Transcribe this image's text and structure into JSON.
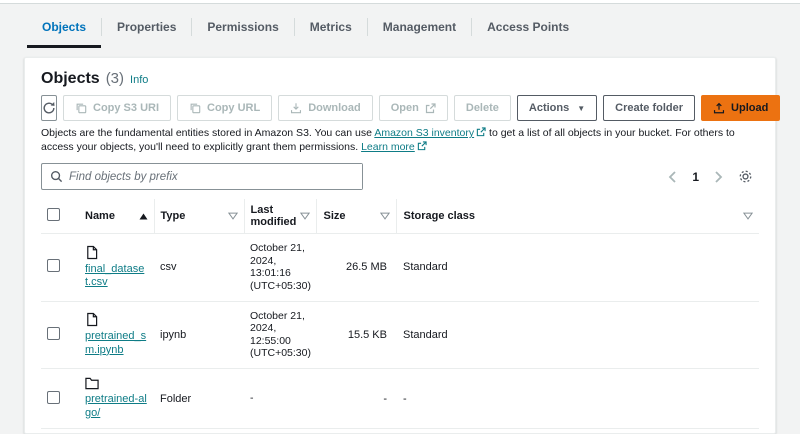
{
  "colors": {
    "accent_orange": "#ec7211",
    "link_teal": "#0e7c86",
    "active_tab_blue": "#0073bb",
    "page_background": "#f2f3f3"
  },
  "tabs": [
    {
      "label": "Objects",
      "active": true
    },
    {
      "label": "Properties",
      "active": false
    },
    {
      "label": "Permissions",
      "active": false
    },
    {
      "label": "Metrics",
      "active": false
    },
    {
      "label": "Management",
      "active": false
    },
    {
      "label": "Access Points",
      "active": false
    }
  ],
  "panel": {
    "title": "Objects",
    "count": "(3)",
    "info_label": "Info",
    "toolbar": {
      "copy_s3_uri": "Copy S3 URI",
      "copy_url": "Copy URL",
      "download": "Download",
      "open": "Open",
      "delete": "Delete",
      "actions": "Actions",
      "actions_caret": "▼",
      "create_folder": "Create folder",
      "upload": "Upload"
    },
    "description": {
      "part1": "Objects are the fundamental entities stored in Amazon S3. You can use ",
      "link1": "Amazon S3 inventory",
      "part2": " to get a list of all objects in your bucket. For others to access your objects, you'll need to explicitly grant them permissions. ",
      "link2": "Learn more"
    },
    "search_placeholder": "Find objects by prefix",
    "pagination": {
      "current": "1"
    },
    "table": {
      "headers": [
        "Name",
        "Type",
        "Last modified",
        "Size",
        "Storage class"
      ],
      "rows": [
        {
          "name": "final_dataset.csv",
          "icon": "file",
          "type": "csv",
          "modified": "October 21, 2024, 13:01:16 (UTC+05:30)",
          "size": "26.5 MB",
          "storage_class": "Standard"
        },
        {
          "name": "pretrained_sm.ipynb",
          "icon": "file",
          "type": "ipynb",
          "modified": "October 21, 2024, 12:55:00 (UTC+05:30)",
          "size": "15.5 KB",
          "storage_class": "Standard"
        },
        {
          "name": "pretrained-algo/",
          "icon": "folder",
          "type": "Folder",
          "modified": "-",
          "size": "-",
          "storage_class": "-"
        }
      ]
    }
  }
}
